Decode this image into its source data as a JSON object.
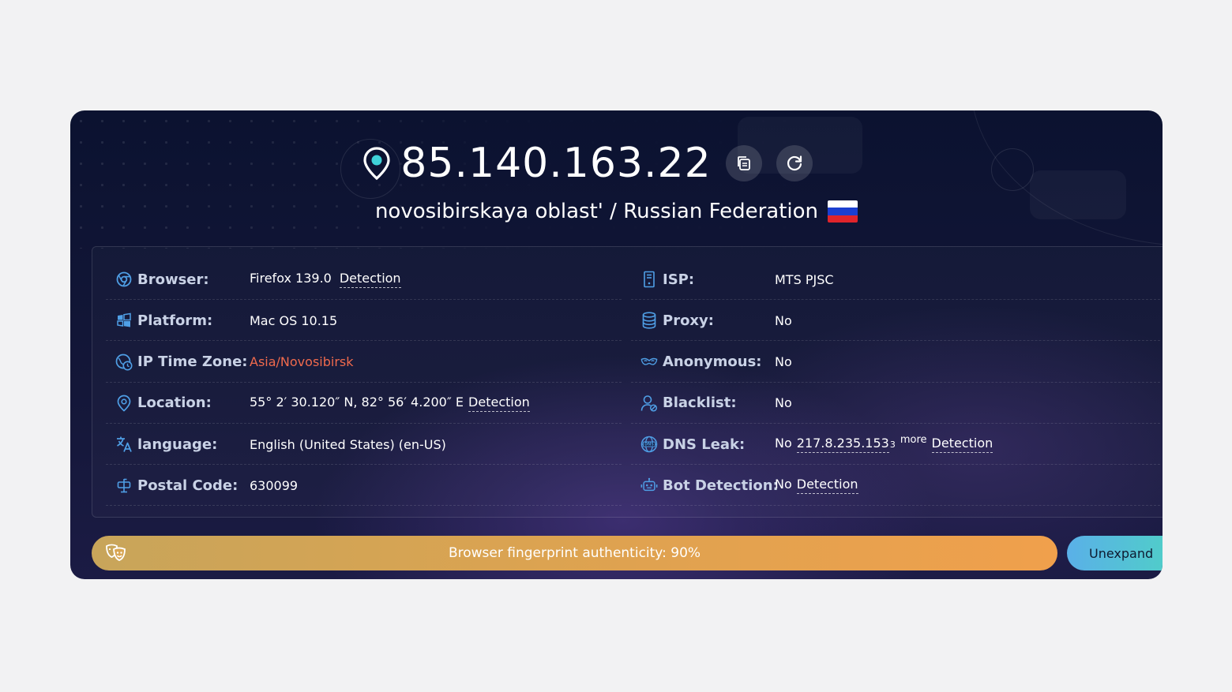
{
  "header": {
    "ip": "85.140.163.22",
    "location": "novosibirskaya oblast' / Russian Federation",
    "flag_colors": [
      "#ffffff",
      "#1c3fd0",
      "#e0242b"
    ]
  },
  "left_rows": [
    {
      "icon": "chrome-icon",
      "label": "Browser:",
      "value": "Firefox 139.0",
      "link": "Detection"
    },
    {
      "icon": "windows-icon",
      "label": "Platform:",
      "value": "Mac OS 10.15"
    },
    {
      "icon": "globe-clock-icon",
      "label": "IP Time Zone:",
      "value": "Asia/Novosibirsk"
    },
    {
      "icon": "location-pin-icon",
      "label": "Location:",
      "value": "55° 2′ 30.120″ N, 82° 56′ 4.200″ E",
      "link": "Detection"
    },
    {
      "icon": "translate-icon",
      "label": "language:",
      "value": "English (United States) (en-US)"
    },
    {
      "icon": "mailbox-icon",
      "label": "Postal Code:",
      "value": "630099"
    }
  ],
  "right_rows": [
    {
      "icon": "server-icon",
      "label": "ISP:",
      "value": "MTS PJSC"
    },
    {
      "icon": "database-icon",
      "label": "Proxy:",
      "value": "No"
    },
    {
      "icon": "mask-icon",
      "label": "Anonymous:",
      "value": "No"
    },
    {
      "icon": "user-blacklist-icon",
      "label": "Blacklist:",
      "value": "No"
    },
    {
      "icon": "dns-globe-icon",
      "label": "DNS Leak:",
      "value": "No",
      "dns_ip": "217.8.235.153",
      "dns_count": "3",
      "more": "more",
      "link": "Detection"
    },
    {
      "icon": "robot-icon",
      "label": "Bot Detection:",
      "value": "No",
      "link": "Detection"
    }
  ],
  "footer": {
    "fingerprint": "Browser fingerprint authenticity: 90%",
    "unexpand": "Unexpand"
  },
  "colors": {
    "accent_blue": "#4f9fe6",
    "timezone_red": "#f06a4d",
    "bar_orange": "#f0a04c",
    "bar_teal": "#4fd0c6"
  }
}
